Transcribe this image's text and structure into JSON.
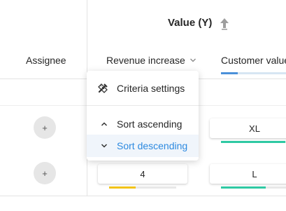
{
  "table": {
    "group_header": "Value (Y)",
    "columns": {
      "assignee": "Assignee",
      "revenue_increase": "Revenue increase",
      "customer_value": "Customer value"
    },
    "rows": [
      {
        "assignee_button": "+",
        "revenue_value": "",
        "customer_value": "XL",
        "customer_score": 0.99
      },
      {
        "assignee_button": "+",
        "revenue_value": "4",
        "revenue_score": 0.4,
        "customer_value": "L",
        "customer_score": 0.69
      }
    ]
  },
  "dropdown_menu": {
    "items": [
      {
        "label": "Criteria settings",
        "icon": "pencil-ruler-icon"
      },
      {
        "label": "Sort ascending",
        "icon": "chevron-up-icon"
      },
      {
        "label": "Sort descending",
        "icon": "chevron-down-icon",
        "highlighted": true
      }
    ]
  },
  "colors": {
    "accent_blue": "#2d8ae0",
    "teal": "#2fc9a3",
    "yellow": "#f2c318"
  }
}
